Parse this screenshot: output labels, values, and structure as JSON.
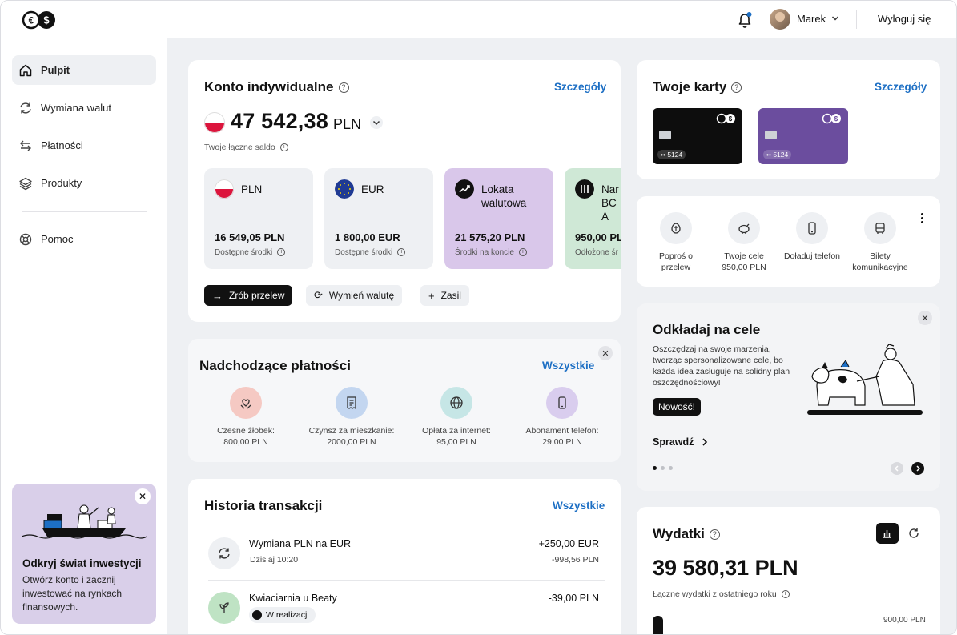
{
  "header": {
    "user_name": "Marek",
    "logout_label": "Wyloguj się"
  },
  "sidebar": {
    "items": [
      {
        "label": "Pulpit",
        "icon": "home-icon",
        "active": true
      },
      {
        "label": "Wymiana walut",
        "icon": "exchange-icon"
      },
      {
        "label": "Płatności",
        "icon": "transfer-arrows-icon"
      },
      {
        "label": "Produkty",
        "icon": "layers-icon"
      },
      {
        "label": "Pomoc",
        "icon": "help-icon"
      }
    ],
    "promo": {
      "title": "Odkryj świat inwestycji",
      "text": "Otwórz konto i zacznij inwestować na rynkach finansowych."
    }
  },
  "account": {
    "title": "Konto indywidualne",
    "details_link": "Szczegóły",
    "balance": "47 542,38",
    "currency": "PLN",
    "balance_caption": "Twoje łączne saldo",
    "tiles": [
      {
        "name": "PLN",
        "amount": "16 549,05 PLN",
        "caption": "Dostępne środki",
        "icon": "poland-flag-icon"
      },
      {
        "name": "EUR",
        "amount": "1 800,00 EUR",
        "caption": "Dostępne środki",
        "icon": "eu-flag-icon"
      },
      {
        "name": "Lokata walutowa",
        "amount": "21 575,20 PLN",
        "caption": "Środki na koncie",
        "icon": "deposit-chart-icon",
        "color": "#d9c7ea"
      },
      {
        "name": "Nar BC A",
        "amount": "950,00 PL",
        "caption": "Odłożone śr",
        "icon": "savings-icon",
        "color": "#cfe8d6"
      }
    ],
    "buttons": {
      "transfer": "Zrób przelew",
      "exchange": "Wymień walutę",
      "topup": "Zasil"
    }
  },
  "upcoming": {
    "title": "Nadchodzące płatności",
    "all_link": "Wszystkie",
    "items": [
      {
        "label": "Czesne żłobek:",
        "amount": "800,00 PLN",
        "color": "#f5c9c3",
        "icon": "heart-hands-icon"
      },
      {
        "label": "Czynsz za mieszkanie:",
        "amount": "2000,00 PLN",
        "color": "#c3d6f0",
        "icon": "receipt-icon"
      },
      {
        "label": "Opłata za internet:",
        "amount": "95,00 PLN",
        "color": "#c6e6e6",
        "icon": "globe-icon"
      },
      {
        "label": "Abonament telefon:",
        "amount": "29,00 PLN",
        "color": "#d9cdee",
        "icon": "phone-icon"
      }
    ]
  },
  "history": {
    "title": "Historia transakcji",
    "all_link": "Wszystkie",
    "rows": [
      {
        "name": "Wymiana PLN na EUR",
        "sub": "Dzisiaj 10:20",
        "amount": "+250,00 EUR",
        "amount2": "-998,56 PLN",
        "icon": "exchange-icon"
      },
      {
        "name": "Kwiaciarnia u Beaty",
        "sub": "W realizacji",
        "amount": "-39,00 PLN",
        "amount2": "",
        "icon": "plant-icon"
      }
    ]
  },
  "cards": {
    "title": "Twoje karty",
    "details_link": "Szczegóły",
    "items": [
      {
        "number": "•• 5124",
        "color": "#0d0d0d"
      },
      {
        "number": "•• 5124",
        "color": "#6b4d9e"
      }
    ]
  },
  "quick_actions": [
    {
      "label": "Poproś o przelew",
      "icon": "request-money-icon"
    },
    {
      "label": "Twoje cele 950,00 PLN",
      "icon": "piggy-bank-icon"
    },
    {
      "label": "Doładuj telefon",
      "icon": "phone-icon"
    },
    {
      "label": "Bilety komunikacyjne",
      "icon": "bus-icon"
    }
  ],
  "goals_promo": {
    "title": "Odkładaj na cele",
    "text": "Oszczędzaj na swoje marzenia, tworząc spersonalizowane cele, bo każda idea zasługuje na solidny plan oszczędnościowy!",
    "badge": "Nowość!",
    "link": "Sprawdź"
  },
  "expenses": {
    "title": "Wydatki",
    "amount": "39 580,31 PLN",
    "caption": "Łączne wydatki z ostatniego roku",
    "axis_max": "900,00 PLN"
  }
}
